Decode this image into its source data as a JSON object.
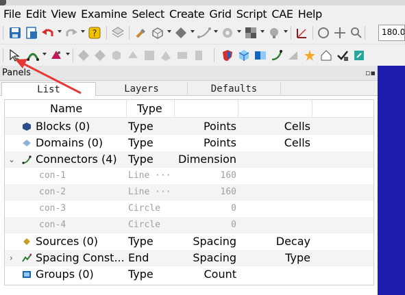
{
  "menubar": {
    "items": [
      "File",
      "Edit",
      "View",
      "Examine",
      "Select",
      "Create",
      "Grid",
      "Script",
      "CAE",
      "Help"
    ]
  },
  "toolbar": {
    "zoom_value": "180.0"
  },
  "panels": {
    "title": "Panels",
    "tabs": [
      "List",
      "Layers",
      "Defaults"
    ],
    "columns": [
      "Name",
      "Type"
    ],
    "rows": [
      {
        "expander": "",
        "icon": "blocks-icon",
        "name": "Blocks (0)",
        "c2": "Type",
        "c3": "Points",
        "c4": "Cells",
        "child": false
      },
      {
        "expander": "",
        "icon": "domains-icon",
        "name": "Domains (0)",
        "c2": "Type",
        "c3": "Points",
        "c4": "Cells",
        "child": false
      },
      {
        "expander": "⌄",
        "icon": "connectors-icon",
        "name": "Connectors (4)",
        "c2": "Type",
        "c3": "Dimension",
        "c4": "",
        "child": false
      },
      {
        "expander": "",
        "icon": "",
        "name": "con-1",
        "c2": "Line ···",
        "c3": "160",
        "c4": "",
        "child": true
      },
      {
        "expander": "",
        "icon": "",
        "name": "con-2",
        "c2": "Line ···",
        "c3": "160",
        "c4": "",
        "child": true
      },
      {
        "expander": "",
        "icon": "",
        "name": "con-3",
        "c2": "Circle",
        "c3": "0",
        "c4": "",
        "child": true
      },
      {
        "expander": "",
        "icon": "",
        "name": "con-4",
        "c2": "Circle",
        "c3": "0",
        "c4": "",
        "child": true
      },
      {
        "expander": "",
        "icon": "sources-icon",
        "name": "Sources (0)",
        "c2": "Type",
        "c3": "Spacing",
        "c4": "Decay",
        "child": false
      },
      {
        "expander": "›",
        "icon": "spacing-constraints-icon",
        "name": "Spacing Const...",
        "c2": "End",
        "c3": "Spacing",
        "c4": "Type",
        "child": false
      },
      {
        "expander": "",
        "icon": "groups-icon",
        "name": "Groups (0)",
        "c2": "Type",
        "c3": "Count",
        "c4": "",
        "child": false
      }
    ]
  },
  "colors": {
    "viewport": "#1d1dae",
    "annotation_arrow": "#e53935"
  }
}
